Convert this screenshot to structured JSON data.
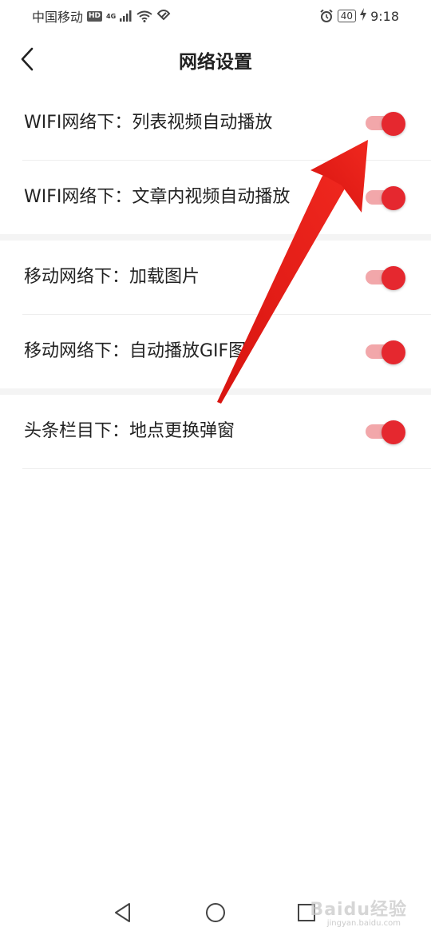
{
  "status_bar": {
    "carrier": "中国移动",
    "hd_badge": "HD",
    "network_type": "4G",
    "battery_level": "40",
    "time": "9:18",
    "icons": [
      "signal-icon",
      "wifi-icon",
      "hotspot-icon",
      "alarm-icon",
      "charging-icon"
    ]
  },
  "header": {
    "title": "网络设置",
    "back_icon": "chevron-left-icon"
  },
  "settings": {
    "items": [
      {
        "label": "WIFI网络下：列表视频自动播放",
        "enabled": true
      },
      {
        "label": "WIFI网络下：文章内视频自动播放",
        "enabled": true
      },
      {
        "label": "移动网络下：加载图片",
        "enabled": true
      },
      {
        "label": "移动网络下：自动播放GIF图",
        "enabled": true
      },
      {
        "label": "头条栏目下：地点更换弹窗",
        "enabled": true
      }
    ]
  },
  "annotation": {
    "arrow_color": "#e8201e"
  },
  "nav_bar": {
    "icons": [
      "back-triangle-icon",
      "home-circle-icon",
      "recent-square-icon"
    ]
  },
  "watermark": {
    "text": "Baidu经验",
    "subtext": "jingyan.baidu.com"
  },
  "colors": {
    "accent": "#e5282f",
    "toggle_track": "#f2a7aa",
    "divider": "#eeeeee",
    "section_gap": "#f4f4f4"
  }
}
